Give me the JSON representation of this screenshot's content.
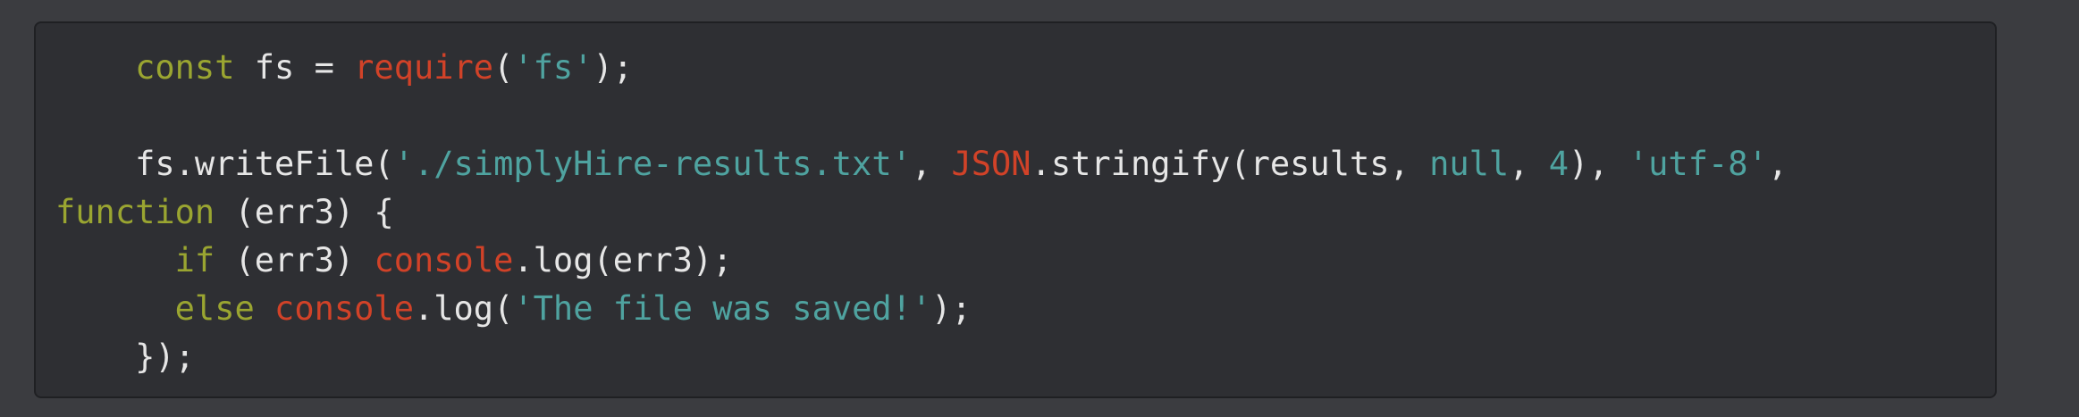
{
  "code": {
    "lines": [
      {
        "tokens": [
          {
            "t": "    ",
            "k": "plain"
          },
          {
            "t": "const",
            "k": "kw"
          },
          {
            "t": " fs = ",
            "k": "plain"
          },
          {
            "t": "require",
            "k": "builtin"
          },
          {
            "t": "(",
            "k": "plain"
          },
          {
            "t": "'fs'",
            "k": "str"
          },
          {
            "t": ");",
            "k": "plain"
          }
        ]
      },
      {
        "tokens": []
      },
      {
        "tokens": [
          {
            "t": "    fs.writeFile(",
            "k": "plain"
          },
          {
            "t": "'./simplyHire-results.txt'",
            "k": "str"
          },
          {
            "t": ", ",
            "k": "plain"
          },
          {
            "t": "JSON",
            "k": "builtin"
          },
          {
            "t": ".stringify(results, ",
            "k": "plain"
          },
          {
            "t": "null",
            "k": "str"
          },
          {
            "t": ", ",
            "k": "plain"
          },
          {
            "t": "4",
            "k": "num"
          },
          {
            "t": "), ",
            "k": "plain"
          },
          {
            "t": "'utf-8'",
            "k": "str"
          },
          {
            "t": ",",
            "k": "plain"
          }
        ]
      },
      {
        "tokens": [
          {
            "t": "function",
            "k": "kw"
          },
          {
            "t": " (err3) {",
            "k": "plain"
          }
        ]
      },
      {
        "tokens": [
          {
            "t": "      ",
            "k": "plain"
          },
          {
            "t": "if",
            "k": "kw"
          },
          {
            "t": " (err3) ",
            "k": "plain"
          },
          {
            "t": "console",
            "k": "builtin"
          },
          {
            "t": ".log(err3);",
            "k": "plain"
          }
        ]
      },
      {
        "tokens": [
          {
            "t": "      ",
            "k": "plain"
          },
          {
            "t": "else",
            "k": "kw"
          },
          {
            "t": " ",
            "k": "plain"
          },
          {
            "t": "console",
            "k": "builtin"
          },
          {
            "t": ".log(",
            "k": "plain"
          },
          {
            "t": "'The file was saved!'",
            "k": "str"
          },
          {
            "t": ");",
            "k": "plain"
          }
        ]
      },
      {
        "tokens": [
          {
            "t": "    });",
            "k": "plain"
          }
        ]
      }
    ]
  },
  "colors": {
    "page_background": "#3b3c40",
    "block_background": "#2e2f33",
    "keyword": "#9aa531",
    "builtin": "#d14228",
    "string": "#4fa3a0",
    "plain": "#e6e6e6"
  }
}
